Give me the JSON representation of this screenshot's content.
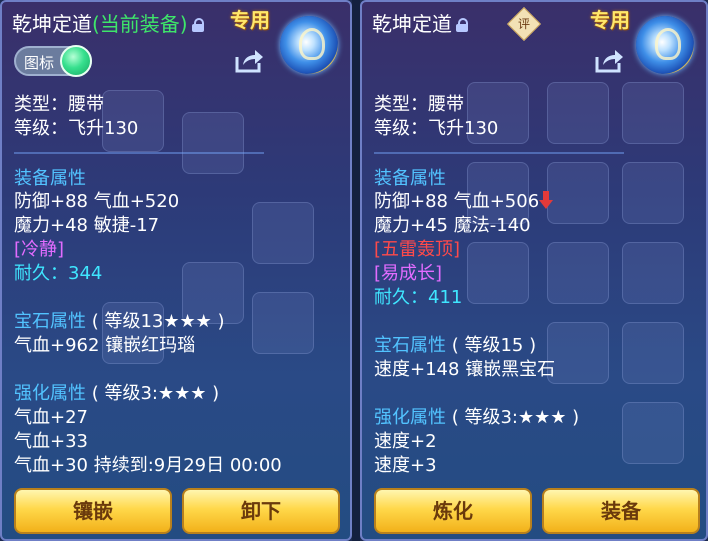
{
  "left": {
    "title": "乾坤定道",
    "current_equipped": "(当前装备)",
    "exclusive": "专用",
    "icon_toggle_label": "图标",
    "type_line": "类型：腰带",
    "level_line": "等级：飞升130",
    "equip_attr_heading": "装备属性",
    "attr_line1": "防御+88 气血+520",
    "attr_line2": "魔力+48 敏捷-17",
    "special": "[冷静]",
    "durability_label": "耐久：",
    "durability_value": "344",
    "gem_heading": "宝石属性",
    "gem_level": "( 等级13★★★ )",
    "gem_line": "气血+962 镶嵌红玛瑙",
    "enhance_heading": "强化属性",
    "enhance_level": "( 等级3:★★★ )",
    "enhance_lines": [
      "气血+27",
      "气血+33",
      "气血+30   持续到:9月29日 00:00"
    ],
    "buttons": [
      "镶嵌",
      "卸下"
    ]
  },
  "right": {
    "title": "乾坤定道",
    "rating_badge": "评",
    "exclusive": "专用",
    "type_line": "类型：腰带",
    "level_line": "等级：飞升130",
    "equip_attr_heading": "装备属性",
    "attr_line1": "防御+88 气血+506",
    "attr_line2": "魔力+45 魔法-140",
    "special1": "[五雷轰顶]",
    "special2": "[易成长]",
    "durability_label": "耐久：",
    "durability_value": "411",
    "gem_heading": "宝石属性",
    "gem_level": "( 等级15 )",
    "gem_line": "速度+148 镶嵌黑宝石",
    "enhance_heading": "强化属性",
    "enhance_level": "( 等级3:★★★ )",
    "enhance_lines": [
      "速度+2",
      "速度+3"
    ],
    "buttons": [
      "炼化",
      "装备"
    ]
  },
  "colors": {
    "section_blue": "#52c3ff",
    "special_pink": "#e26cff",
    "special_red": "#ff4a4a",
    "durability_cyan": "#3fe6ff",
    "current_green": "#3ee66a",
    "exclusive_gold": "#ffe76a",
    "decrease_arrow": "#e23a3a"
  }
}
